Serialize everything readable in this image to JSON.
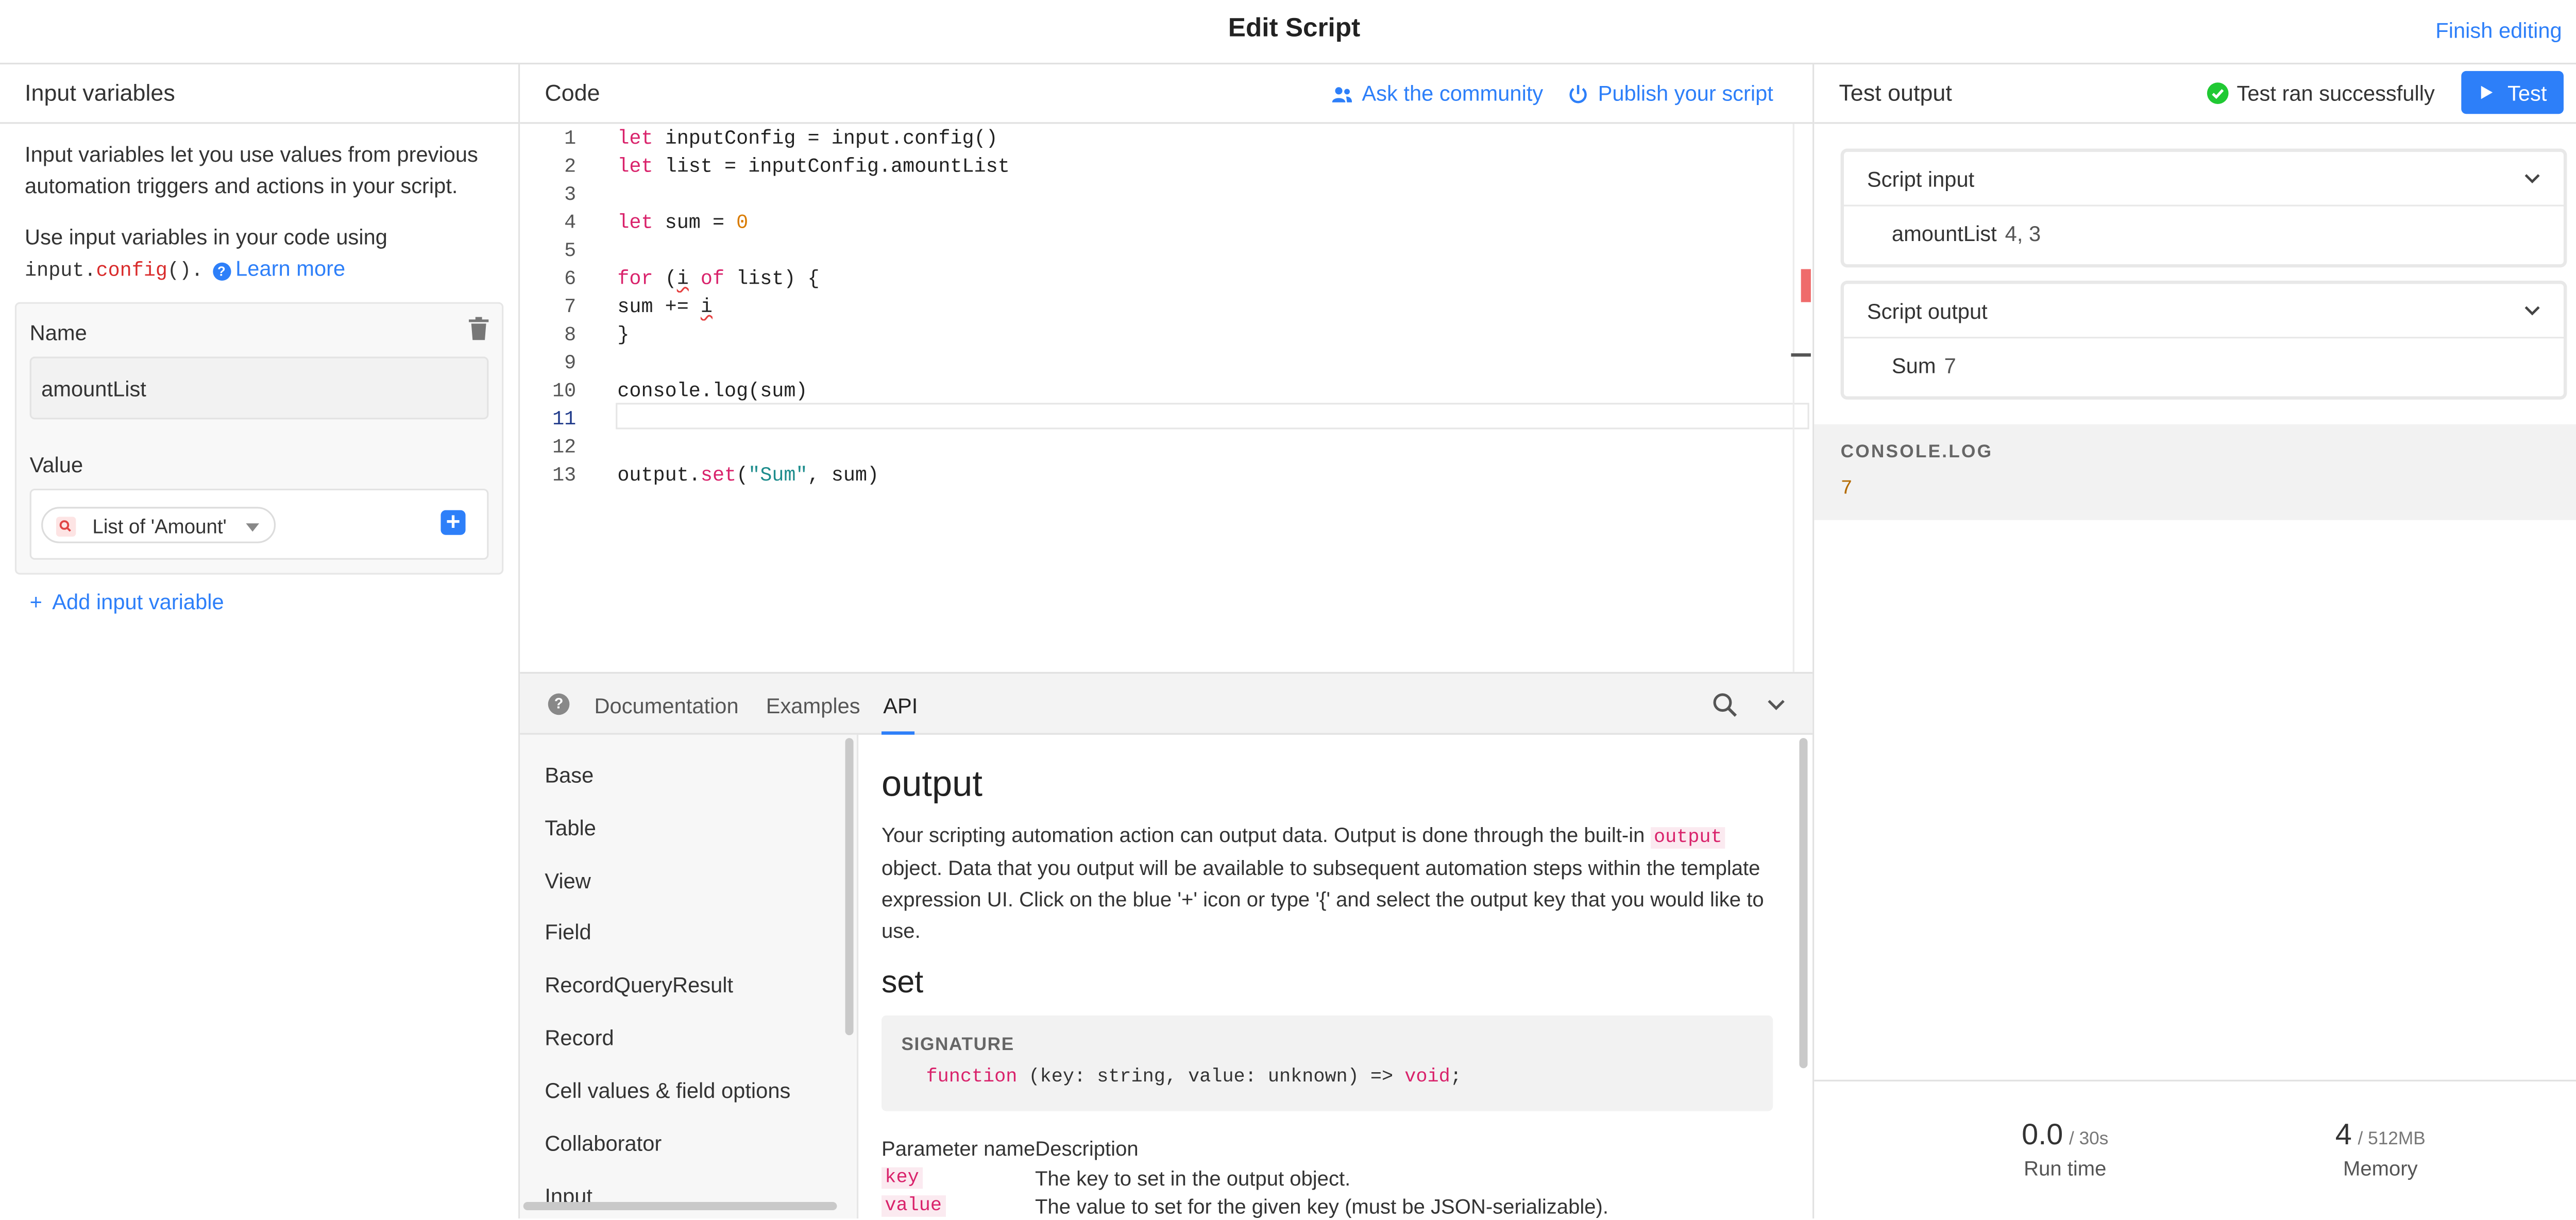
{
  "header": {
    "title": "Edit Script",
    "finish_label": "Finish editing"
  },
  "left": {
    "title": "Input variables",
    "desc": "Input variables let you use values from previous automation triggers and actions in your script.",
    "desc2_prefix": "Use input variables in your code using",
    "desc2_code_a": "input.",
    "desc2_code_b": "config",
    "desc2_code_c": "().",
    "learn_more": "Learn more",
    "name_label": "Name",
    "name_value": "amountList",
    "value_label": "Value",
    "value_pill": "List of 'Amount'",
    "add_label": "Add input variable"
  },
  "code": {
    "title": "Code",
    "ask_label": "Ask the community",
    "publish_label": "Publish your script",
    "line_numbers": [
      "1",
      "2",
      "3",
      "4",
      "5",
      "6",
      "7",
      "8",
      "9",
      "10",
      "11",
      "12",
      "13"
    ]
  },
  "docs": {
    "tabs": [
      "Documentation",
      "Examples",
      "API"
    ],
    "active_tab": "API",
    "nav": [
      "Base",
      "Table",
      "View",
      "Field",
      "RecordQueryResult",
      "Record",
      "Cell values & field options",
      "Collaborator",
      "Input"
    ],
    "heading": "output",
    "para_a": "Your scripting automation action can output data. Output is done through the built-in",
    "para_code": "output",
    "para_b": "object. Data that you output will be available to subsequent automation steps within the template expression UI. Click on the blue '+' icon or type '{' and select the output key that you would like to use.",
    "subheading": "set",
    "signature_label": "SIGNATURE",
    "signature_kw": "function",
    "signature_mid": " (key: string, value: unknown) => ",
    "signature_ret": "void",
    "signature_end": ";",
    "param_header": "Parameter nameDescription",
    "params": [
      {
        "name": "key",
        "desc": "The key to set in the output object."
      },
      {
        "name": "value",
        "desc": "The value to set for the given key (must be JSON-serializable)."
      }
    ]
  },
  "test": {
    "title": "Test output",
    "status": "Test ran successfully",
    "test_label": "Test",
    "input_title": "Script input",
    "input_key": "amountList",
    "input_val": "4, 3",
    "output_title": "Script output",
    "output_key": "Sum",
    "output_val": "7",
    "console_label": "CONSOLE.LOG",
    "console_val": "7",
    "runtime_val": "0.0",
    "runtime_limit": "/ 30s",
    "runtime_cap": "Run time",
    "memory_val": "4",
    "memory_limit": "/ 512MB",
    "memory_cap": "Memory"
  },
  "colors": {
    "accent": "#2d7ff9",
    "success": "#20c933",
    "keyword": "#d9226b"
  }
}
